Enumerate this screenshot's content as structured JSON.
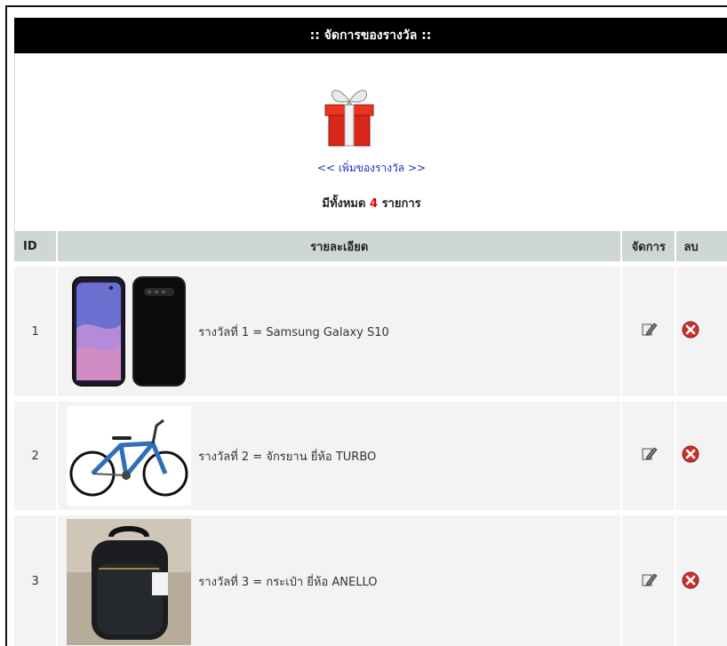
{
  "header": {
    "title": ":: จัดการของรางวัล ::"
  },
  "intro": {
    "add_link": "<< เพิ่มของรางวัล >>",
    "count_prefix": "มีทั้งหมด",
    "count_value": "4",
    "count_suffix": "รายการ"
  },
  "table": {
    "headers": {
      "id": "ID",
      "detail": "รายละเอียด",
      "manage": "จัดการ",
      "delete": "ลบ"
    },
    "rows": [
      {
        "id": "1",
        "text": "รางวัลที่ 1 = Samsung Galaxy S10",
        "image": "smartphone"
      },
      {
        "id": "2",
        "text": "รางวัลที่ 2 = จักรยาน ยี่ห้อ TURBO",
        "image": "bicycle"
      },
      {
        "id": "3",
        "text": "รางวัลที่ 3 = กระเป๋า ยี่ห้อ ANELLO",
        "image": "backpack"
      }
    ]
  },
  "icons": {
    "edit": "edit-icon",
    "delete": "delete-icon",
    "gift": "gift-icon"
  },
  "colors": {
    "header_bg": "#000000",
    "accent_red": "#e40000",
    "link_blue": "#1d2fb8",
    "table_header_bg": "#cfd6d6"
  }
}
